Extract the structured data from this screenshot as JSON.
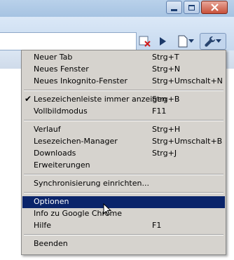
{
  "menu": {
    "items": [
      {
        "label": "Neuer Tab",
        "shortcut": "Strg+T"
      },
      {
        "label": "Neues Fenster",
        "shortcut": "Strg+N"
      },
      {
        "label": "Neues Inkognito-Fenster",
        "shortcut": "Strg+Umschalt+N"
      },
      {
        "label": "Lesezeichenleiste immer anzeigen",
        "shortcut": "Strg+B",
        "checked": true
      },
      {
        "label": "Vollbildmodus",
        "shortcut": "F11"
      },
      {
        "label": "Verlauf",
        "shortcut": "Strg+H"
      },
      {
        "label": "Lesezeichen-Manager",
        "shortcut": "Strg+Umschalt+B"
      },
      {
        "label": "Downloads",
        "shortcut": "Strg+J"
      },
      {
        "label": "Erweiterungen",
        "shortcut": ""
      },
      {
        "label": "Synchronisierung einrichten...",
        "shortcut": ""
      },
      {
        "label": "Optionen",
        "shortcut": "",
        "selected": true
      },
      {
        "label": "Info zu Google Chrome",
        "shortcut": ""
      },
      {
        "label": "Hilfe",
        "shortcut": "F1"
      },
      {
        "label": "Beenden",
        "shortcut": ""
      }
    ]
  },
  "icons": {
    "checkmark": "check-icon",
    "minimize": "minimize-icon",
    "maximize": "maximize-icon",
    "close": "close-icon",
    "page_menu": "page-icon",
    "wrench": "wrench-icon"
  },
  "colors": {
    "menu_bg": "#d6d3ce",
    "selection": "#0a246a"
  }
}
